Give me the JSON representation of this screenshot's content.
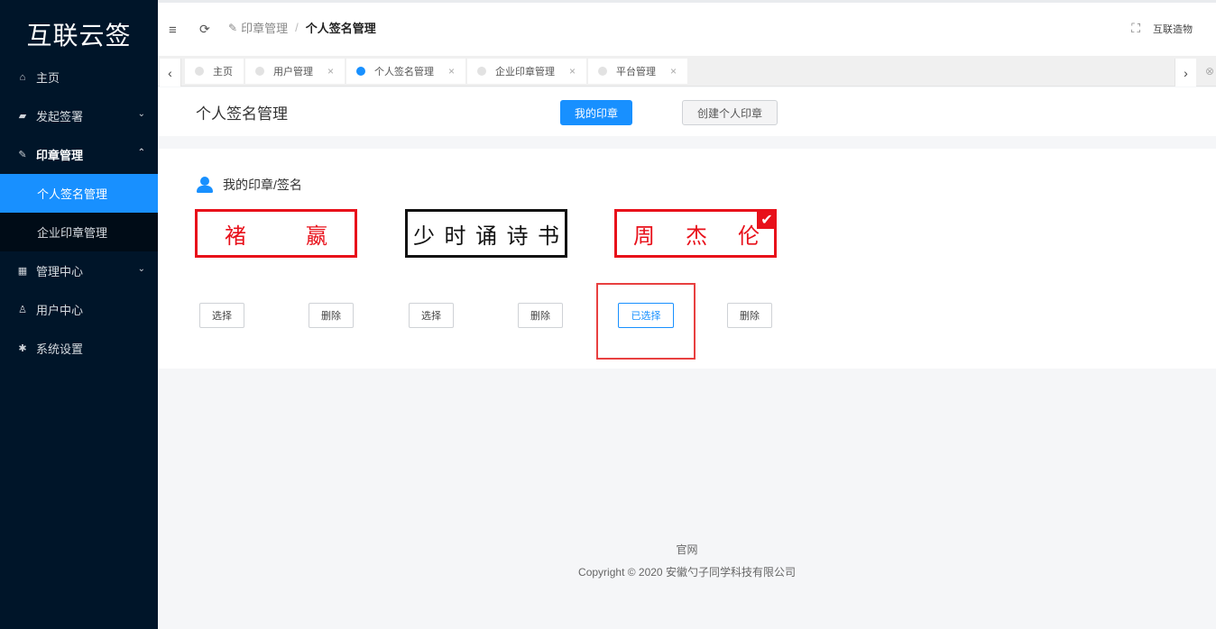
{
  "app": {
    "logo": "互联云签"
  },
  "sidebar": {
    "items": [
      {
        "label": "主页",
        "icon": "home-icon"
      },
      {
        "label": "发起签署",
        "icon": "sign-icon"
      },
      {
        "label": "印章管理",
        "icon": "pen-icon",
        "sub": [
          "个人签名管理",
          "企业印章管理"
        ]
      },
      {
        "label": "管理中心",
        "icon": "grid-icon"
      },
      {
        "label": "用户中心",
        "icon": "user-icon"
      },
      {
        "label": "系统设置",
        "icon": "gear-icon"
      }
    ]
  },
  "header": {
    "breadcrumb": [
      "印章管理",
      "个人签名管理"
    ],
    "user": "互联造物"
  },
  "tabs": [
    {
      "label": "主页",
      "active": false
    },
    {
      "label": "用户管理",
      "active": false
    },
    {
      "label": "个人签名管理",
      "active": true
    },
    {
      "label": "企业印章管理",
      "active": false
    },
    {
      "label": "平台管理",
      "active": false
    }
  ],
  "page": {
    "title": "个人签名管理",
    "primary_button": "我的印章",
    "create_button": "创建个人印章",
    "section_title": "我的印章/签名"
  },
  "seals": [
    {
      "chars": [
        "褚",
        "嬴"
      ],
      "color": "#e8101a",
      "selected": false,
      "select_label": "选择",
      "delete_label": "删除"
    },
    {
      "chars": [
        "少",
        "时",
        "诵",
        "诗",
        "书"
      ],
      "color": "#111111",
      "selected": false,
      "select_label": "选择",
      "delete_label": "删除"
    },
    {
      "chars": [
        "周",
        "杰",
        "伦"
      ],
      "color": "#e8101a",
      "selected": true,
      "select_label": "已选择",
      "delete_label": "删除"
    }
  ],
  "footer": {
    "link": "官网",
    "copyright": "Copyright © 2020 安徽勺子同学科技有限公司"
  }
}
